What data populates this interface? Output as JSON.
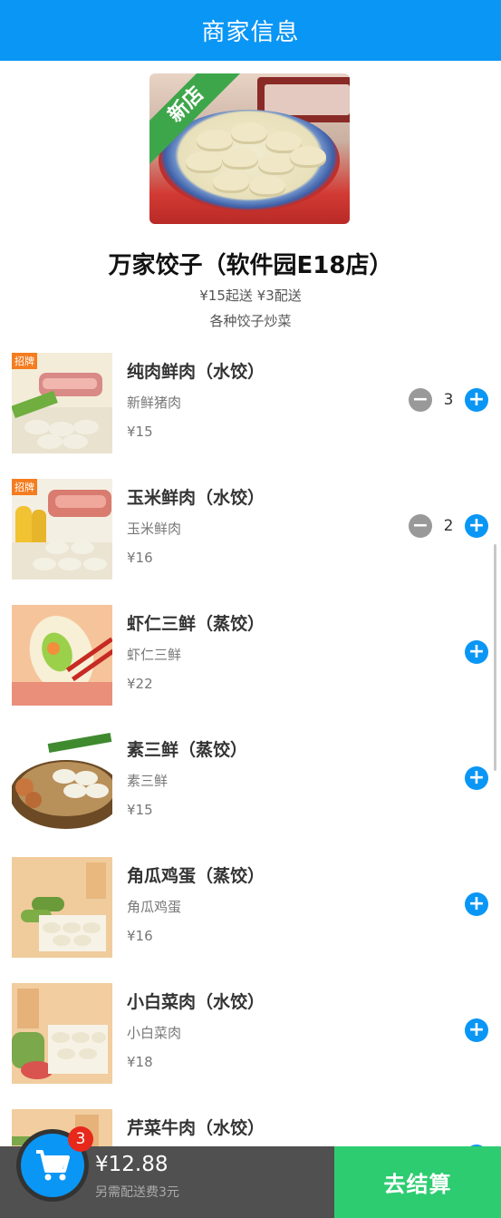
{
  "header": {
    "title": "商家信息"
  },
  "shop": {
    "ribbon": "新店",
    "name": "万家饺子（软件园E18店）",
    "fees": "¥15起送 ¥3配送",
    "description": "各种饺子炒菜"
  },
  "items": [
    {
      "badge": "招牌",
      "name": "纯肉鲜肉（水饺）",
      "desc": "新鲜猪肉",
      "price": "¥15",
      "count": "3",
      "image": "pork-dumplings-photo"
    },
    {
      "badge": "招牌",
      "name": "玉米鲜肉（水饺）",
      "desc": "玉米鲜肉",
      "price": "¥16",
      "count": "2",
      "image": "corn-pork-dumplings-photo"
    },
    {
      "badge": "",
      "name": "虾仁三鲜（蒸饺）",
      "desc": "虾仁三鲜",
      "price": "¥22",
      "count": "",
      "image": "shrimp-dumpling-photo"
    },
    {
      "badge": "",
      "name": "素三鲜（蒸饺）",
      "desc": "素三鲜",
      "price": "¥15",
      "count": "",
      "image": "vegetable-dumplings-photo"
    },
    {
      "badge": "",
      "name": "角瓜鸡蛋（蒸饺）",
      "desc": "角瓜鸡蛋",
      "price": "¥16",
      "count": "",
      "image": "zucchini-egg-dumplings-photo"
    },
    {
      "badge": "",
      "name": "小白菜肉（水饺）",
      "desc": "小白菜肉",
      "price": "¥18",
      "count": "",
      "image": "bokchoy-pork-dumplings-photo"
    },
    {
      "badge": "",
      "name": "芹菜牛肉（水饺）",
      "desc": "",
      "price": "",
      "count": "",
      "image": "celery-beef-dumplings-photo"
    }
  ],
  "cart": {
    "badge_count": "3",
    "total": "¥12.88",
    "extra_fee": "另需配送费3元",
    "checkout_label": "去结算"
  },
  "icons": {
    "cart": "cart-icon",
    "minus": "minus-circle-icon",
    "plus": "plus-circle-icon"
  },
  "colors": {
    "primary": "#0a96f5",
    "checkout": "#2ecc71",
    "badge": "#e7281a",
    "tag": "#f57c1f"
  }
}
